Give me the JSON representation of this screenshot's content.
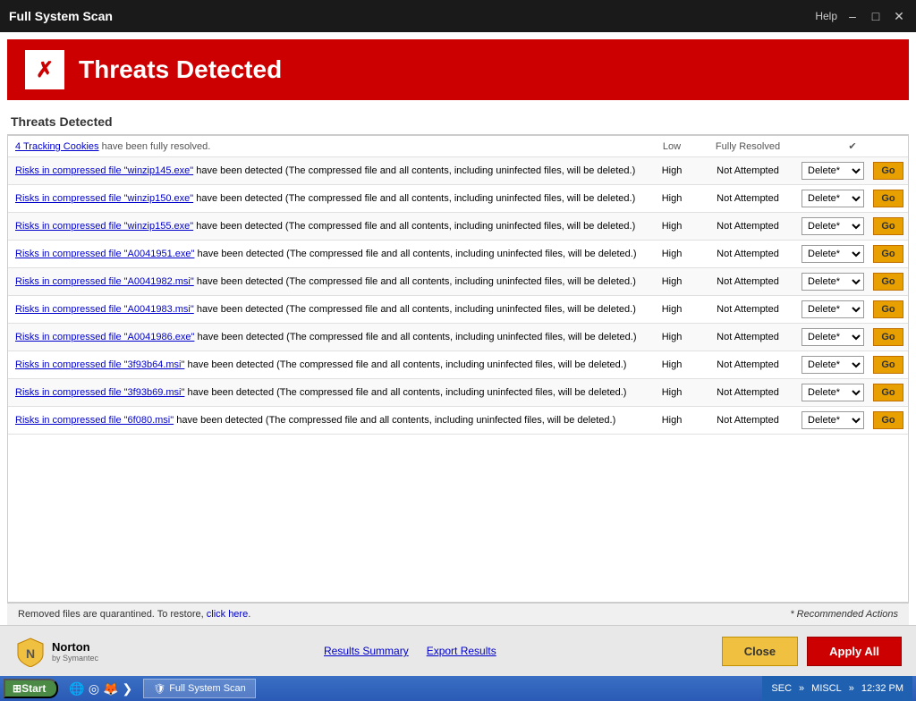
{
  "titleBar": {
    "title": "Full System Scan",
    "helpLabel": "Help"
  },
  "banner": {
    "title": "Threats Detected"
  },
  "sectionTitle": "Threats Detected",
  "table": {
    "firstRow": {
      "description": "4 Tracking Cookies have been fully resolved.",
      "severity": "Low",
      "status": "Fully Resolved",
      "hasCheckmark": true
    },
    "rows": [
      {
        "linkText": "Risks in compressed file \"winzip145.exe\"",
        "descSuffix": " have been detected (The compressed file and all contents, including uninfected files, will be deleted.)",
        "severity": "High",
        "status": "Not Attempted",
        "action": "Delete*"
      },
      {
        "linkText": "Risks in compressed file \"winzip150.exe\"",
        "descSuffix": " have been detected (The compressed file and all contents, including uninfected files, will be deleted.)",
        "severity": "High",
        "status": "Not Attempted",
        "action": "Delete*"
      },
      {
        "linkText": "Risks in compressed file \"winzip155.exe\"",
        "descSuffix": " have been detected (The compressed file and all contents, including uninfected files, will be deleted.)",
        "severity": "High",
        "status": "Not Attempted",
        "action": "Delete*"
      },
      {
        "linkText": "Risks in compressed file \"A0041951.exe\"",
        "descSuffix": " have been detected (The compressed file and all contents, including uninfected files, will be deleted.)",
        "severity": "High",
        "status": "Not Attempted",
        "action": "Delete*"
      },
      {
        "linkText": "Risks in compressed file \"A0041982.msi\"",
        "descSuffix": " have been detected (The compressed file and all contents, including uninfected files, will be deleted.)",
        "severity": "High",
        "status": "Not Attempted",
        "action": "Delete*"
      },
      {
        "linkText": "Risks in compressed file \"A0041983.msi\"",
        "descSuffix": " have been detected (The compressed file and all contents, including uninfected files, will be deleted.)",
        "severity": "High",
        "status": "Not Attempted",
        "action": "Delete*"
      },
      {
        "linkText": "Risks in compressed file \"A0041986.exe\"",
        "descSuffix": " have been detected (The compressed file and all contents, including uninfected files, will be deleted.)",
        "severity": "High",
        "status": "Not Attempted",
        "action": "Delete*"
      },
      {
        "linkText": "Risks in compressed file \"3f93b64.msi\"",
        "descSuffix": " have been detected (The compressed file and all contents, including uninfected files, will be deleted.)",
        "severity": "High",
        "status": "Not Attempted",
        "action": "Delete*"
      },
      {
        "linkText": "Risks in compressed file \"3f93b69.msi\"",
        "descSuffix": " have been detected (The compressed file and all contents, including uninfected files, will be deleted.)",
        "severity": "High",
        "status": "Not Attempted",
        "action": "Delete*"
      },
      {
        "linkText": "Risks in compressed file \"6f080.msi\"",
        "descSuffix": " have been detected (The compressed file and all contents, including uninfected files, will be deleted.)",
        "severity": "High",
        "status": "Not Attempted",
        "action": "Delete*"
      }
    ],
    "goLabel": "Go"
  },
  "footer": {
    "note": "Removed files are quarantined. To restore, ",
    "linkText": "click here",
    "recommended": "* Recommended Actions"
  },
  "actionBar": {
    "resultsSummary": "Results Summary",
    "exportResults": "Export Results",
    "closeLabel": "Close",
    "applyAllLabel": "Apply All"
  },
  "taskbar": {
    "startLabel": "Start",
    "appLabel": "Full System Scan",
    "time": "12:32 PM",
    "sec": "SEC",
    "misc": "MISCL"
  }
}
